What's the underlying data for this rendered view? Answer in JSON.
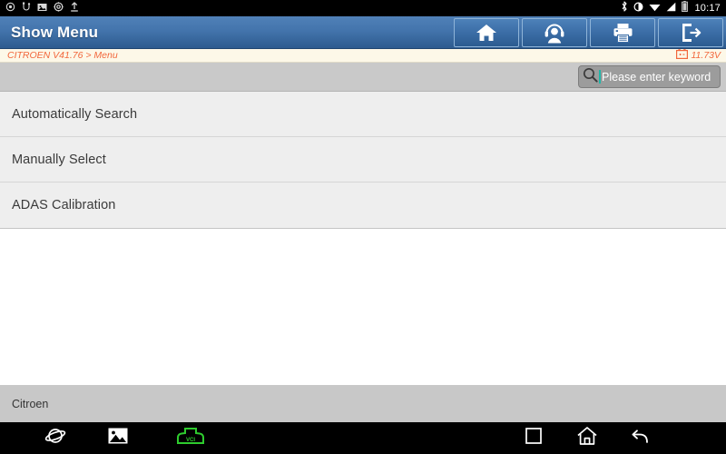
{
  "statusbar": {
    "left_icons": [
      {
        "name": "usb-debug-icon",
        "glyph": "◎"
      },
      {
        "name": "usb-connection-icon",
        "glyph": "ψ"
      },
      {
        "name": "screenshot-icon",
        "glyph": "▣"
      },
      {
        "name": "settings-alert-icon",
        "glyph": "☸"
      },
      {
        "name": "upload-icon",
        "glyph": "⤒"
      }
    ],
    "right_icons": [
      {
        "name": "bluetooth-icon"
      },
      {
        "name": "brightness-icon"
      },
      {
        "name": "wifi-icon"
      },
      {
        "name": "cellular-signal-icon"
      },
      {
        "name": "battery-icon"
      }
    ],
    "time": "10:17"
  },
  "titlebar": {
    "title": "Show Menu",
    "buttons": [
      {
        "name": "home-button",
        "icon": "home-icon"
      },
      {
        "name": "support-button",
        "icon": "headset-user-icon"
      },
      {
        "name": "print-button",
        "icon": "printer-icon"
      },
      {
        "name": "exit-button",
        "icon": "exit-door-icon"
      }
    ]
  },
  "breadcrumb": {
    "path": "CITROEN V41.76 > Menu",
    "voltage": "11.73V",
    "voltage_icon": "car-battery-icon",
    "text_color": "#f2673c"
  },
  "search": {
    "placeholder": "Please enter keyword",
    "icon": "search-icon",
    "caret_color": "#1fb6a8"
  },
  "menu": {
    "items": [
      {
        "label": "Automatically Search"
      },
      {
        "label": "Manually Select"
      },
      {
        "label": "ADAS Calibration"
      }
    ]
  },
  "footer": {
    "label": "Citroen"
  },
  "navbar": {
    "browser": {
      "name": "browser-icon"
    },
    "gallery": {
      "name": "gallery-icon"
    },
    "vci": {
      "name": "vci-connector-icon",
      "label": "VCI",
      "color": "#2ecc2e"
    },
    "recent": {
      "name": "recents-icon"
    },
    "home": {
      "name": "home-icon"
    },
    "back": {
      "name": "back-icon"
    }
  }
}
